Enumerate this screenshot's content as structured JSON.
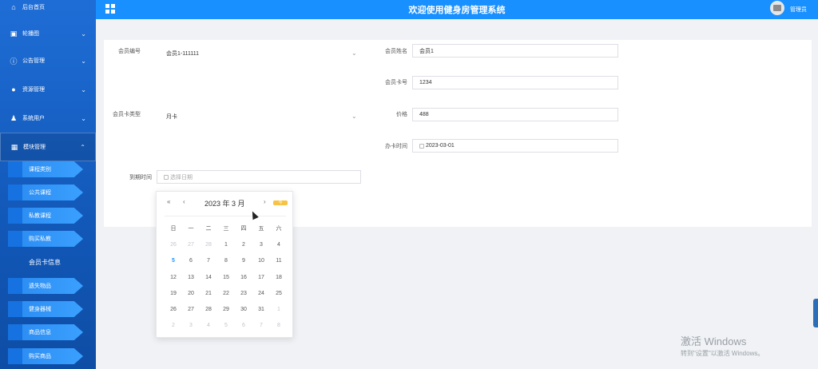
{
  "sidebar": {
    "home": "后台首页",
    "carousel": "轮播图",
    "announce": "公告管理",
    "resource": "资源管理",
    "sysuser": "系统用户",
    "module": "模块管理",
    "sub": [
      "课程类别",
      "公共课程",
      "私教课程",
      "购买私教",
      "会员卡信息",
      "遗失物品",
      "健身器械",
      "商品信息",
      "购买商品"
    ]
  },
  "header": {
    "title": "欢迎使用健身房管理系统",
    "user": "管理员"
  },
  "form": {
    "member_no_label": "会员编号",
    "member_no_value": "会员1-111111",
    "member_name_label": "会员姓名",
    "member_name_value": "会员1",
    "card_no_label": "会员卡号",
    "card_no_value": "1234",
    "card_type_label": "会员卡类型",
    "card_type_value": "月卡",
    "price_label": "价格",
    "price_value": "488",
    "issue_time_label": "办卡时间",
    "issue_time_value": "2023-03-01",
    "expire_label": "到期时间",
    "expire_placeholder": "选择日期"
  },
  "calendar": {
    "title": "2023 年  3 月",
    "prev_year": "«",
    "prev_month": "‹",
    "next_month": "›",
    "today_badge": "今",
    "weekdays": [
      "日",
      "一",
      "二",
      "三",
      "四",
      "五",
      "六"
    ],
    "weeks": [
      [
        "26",
        "27",
        "28",
        "1",
        "2",
        "3",
        "4"
      ],
      [
        "5",
        "6",
        "7",
        "8",
        "9",
        "10",
        "11"
      ],
      [
        "12",
        "13",
        "14",
        "15",
        "16",
        "17",
        "18"
      ],
      [
        "19",
        "20",
        "21",
        "22",
        "23",
        "24",
        "25"
      ],
      [
        "26",
        "27",
        "28",
        "29",
        "30",
        "31",
        "1"
      ],
      [
        "2",
        "3",
        "4",
        "5",
        "6",
        "7",
        "8"
      ]
    ]
  },
  "watermark": {
    "line1": "激活 Windows",
    "line2": "转到\"设置\"以激活 Windows。"
  }
}
